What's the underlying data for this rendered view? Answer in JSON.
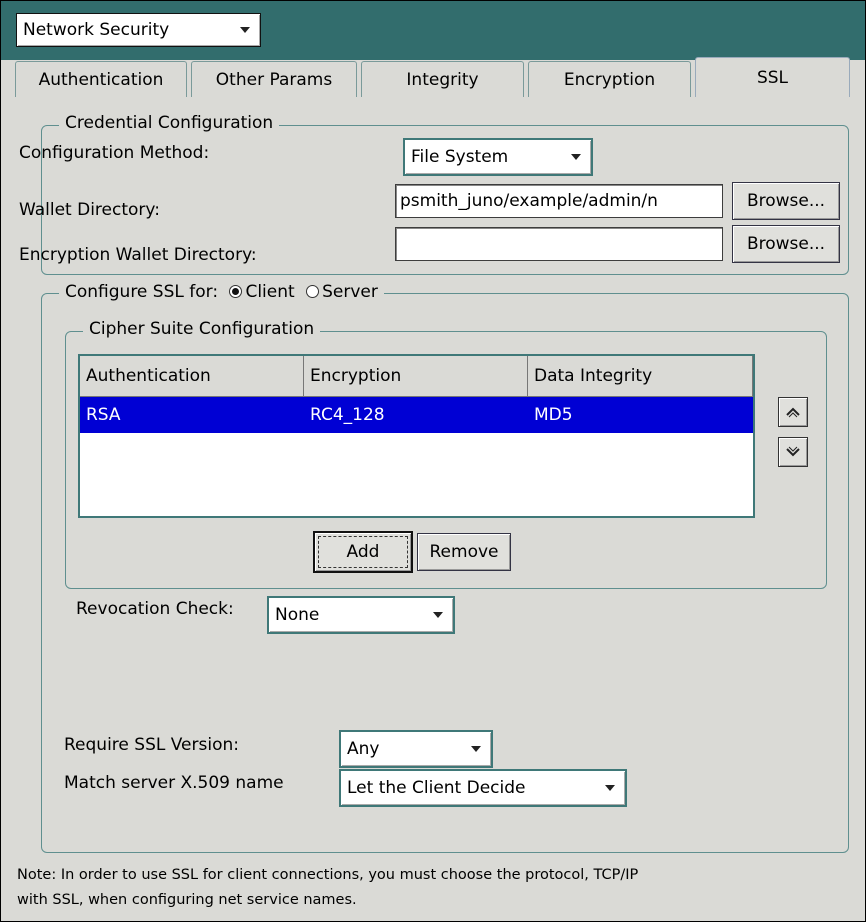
{
  "header": {
    "dropdown_value": "Network Security"
  },
  "tabs": [
    {
      "label": "Authentication",
      "selected": false
    },
    {
      "label": "Other Params",
      "selected": false
    },
    {
      "label": "Integrity",
      "selected": false
    },
    {
      "label": "Encryption",
      "selected": false
    },
    {
      "label": "SSL",
      "selected": true
    }
  ],
  "credential": {
    "legend": "Credential Configuration",
    "method_label": "Configuration Method:",
    "method_value": "File System",
    "wallet_label": "Wallet Directory:",
    "wallet_value": "psmith_juno/example/admin/n",
    "enc_wallet_label": "Encryption Wallet Directory:",
    "enc_wallet_value": "",
    "browse_label": "Browse..."
  },
  "ssl": {
    "legend": "Configure SSL for:",
    "client_label": "Client",
    "server_label": "Server",
    "client_selected": true
  },
  "cipher": {
    "legend": "Cipher Suite Configuration",
    "columns": [
      "Authentication",
      "Encryption",
      "Data Integrity"
    ],
    "rows": [
      {
        "authentication": "RSA",
        "encryption": "RC4_128",
        "integrity": "MD5",
        "selected": true
      }
    ],
    "add_label": "Add",
    "remove_label": "Remove"
  },
  "revocation": {
    "label": "Revocation Check:",
    "value": "None"
  },
  "ssl_version": {
    "label": "Require SSL Version:",
    "value": "Any"
  },
  "match_server": {
    "label": "Match server X.509 name",
    "value": "Let the Client Decide"
  },
  "note": {
    "line1": "Note: In order to use SSL for client connections, you must choose the protocol, TCP/IP",
    "line2": "with SSL, when configuring net service names."
  },
  "colors": {
    "header_bg": "#326d6d",
    "panel_bg": "#dadad6",
    "selection": "#0000d4",
    "border_accent": "#3f7878"
  }
}
